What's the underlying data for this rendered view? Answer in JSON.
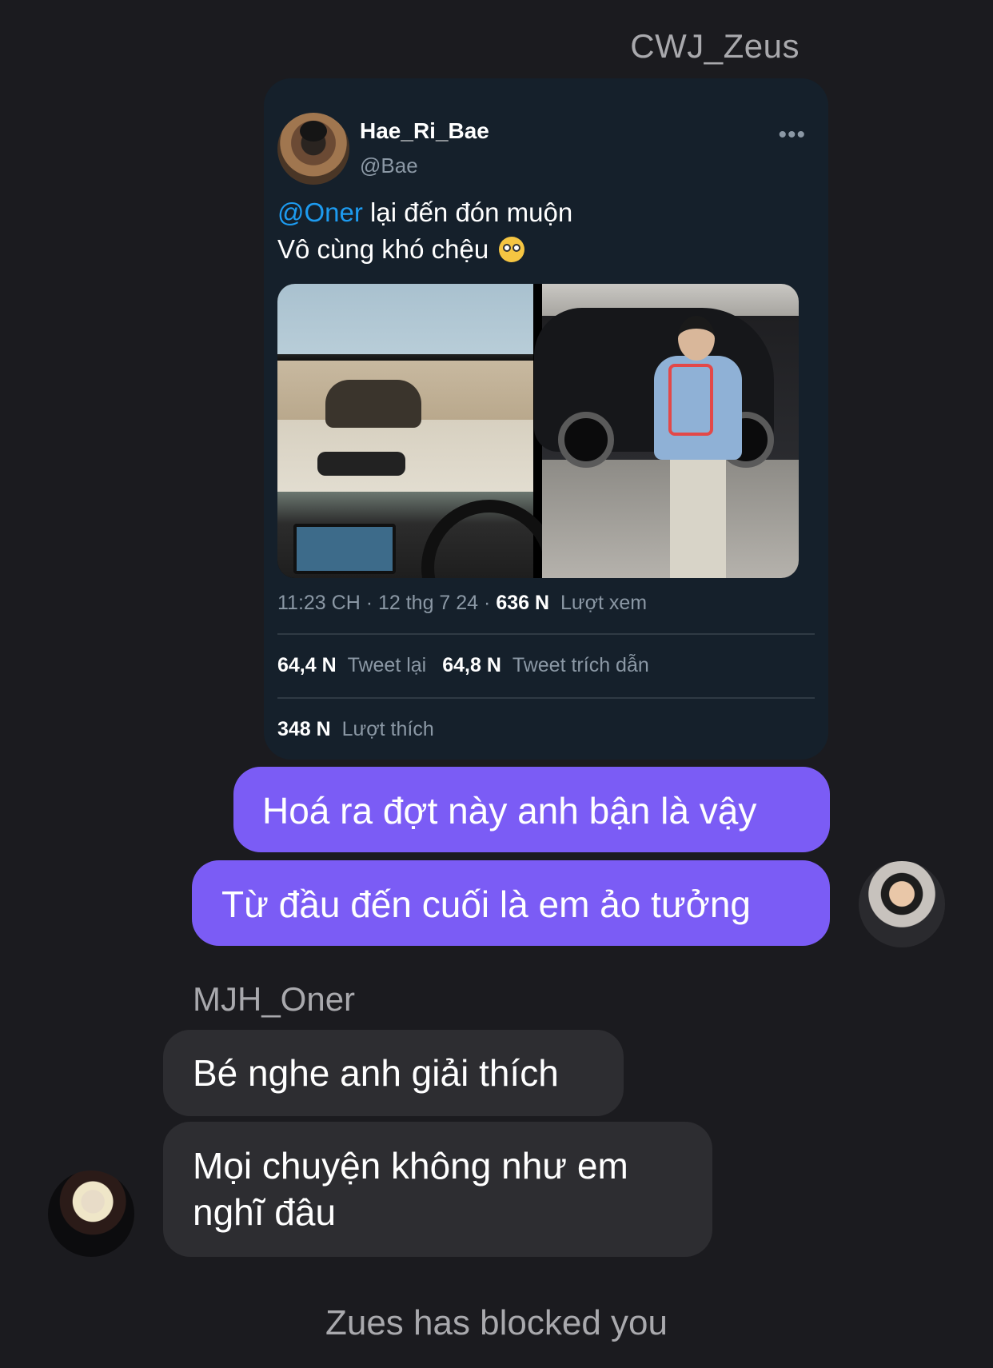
{
  "conversation": {
    "sender_top": "CWJ_Zeus",
    "shared_tweet": {
      "display_name": "Hae_Ri_Bae",
      "handle": "@Bae",
      "more_glyph": "•••",
      "mention": "@Oner",
      "text_line1": " lại đến đón muộn",
      "text_line2": "Vô cùng khó chệu",
      "emoji": "face-with-rolling-eyes",
      "meta": {
        "time_date": "11:23 CH · 12 thg 7 24 · ",
        "views_count": "636 N",
        "views_label": "Lượt xem"
      },
      "stats": {
        "retweets_count": "64,4 N",
        "retweets_label": "Tweet lại",
        "quotes_count": "64,8 N",
        "quotes_label": "Tweet trích dẫn",
        "likes_count": "348 N",
        "likes_label": "Lượt thích"
      },
      "images": [
        "car-interior-photo",
        "man-standing-by-car-photo"
      ]
    },
    "outgoing_messages": [
      "Hoá ra đợt này anh bận là vậy",
      "Từ đầu đến cuối là em ảo tưởng"
    ],
    "sender_incoming": "MJH_Oner",
    "incoming_messages": [
      "Bé nghe anh giải thích",
      "Mọi chuyện không như em nghĩ đâu"
    ],
    "system_notice": "Zues has blocked you"
  },
  "colors": {
    "background": "#1b1b1f",
    "outgoing_bubble": "#7b5cf5",
    "incoming_bubble": "#2d2d31",
    "tweet_card": "#15202b",
    "mention": "#1d9bf0",
    "muted_text": "#a9a9ad"
  }
}
